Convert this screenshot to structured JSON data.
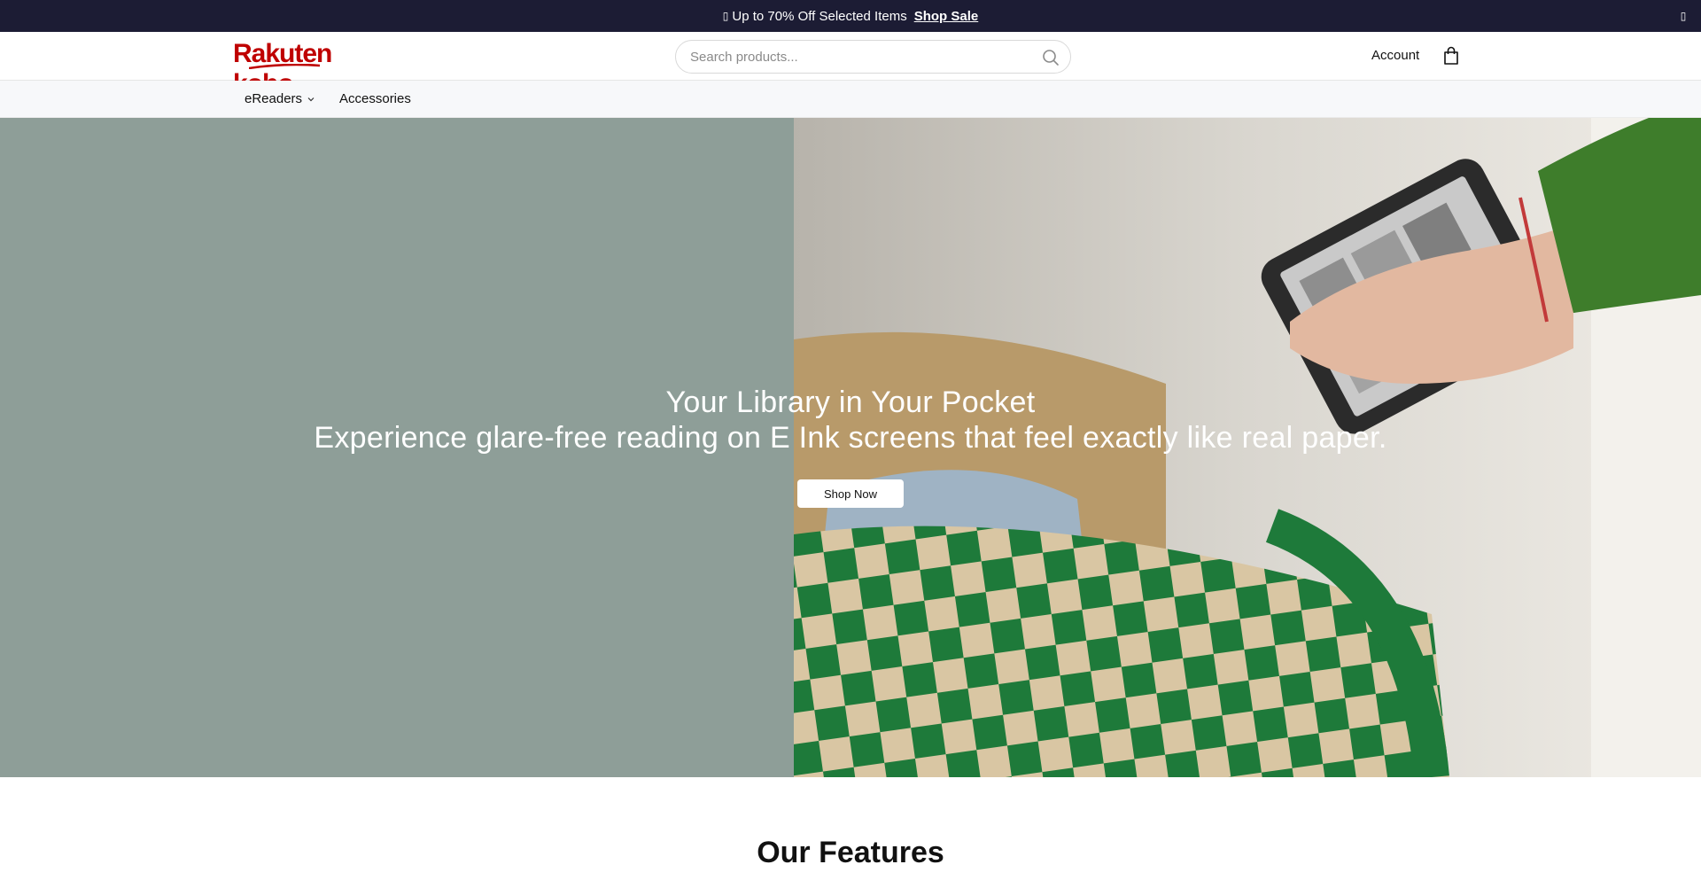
{
  "announcement": {
    "flag_glyph": "▯",
    "message": "Up to 70% Off Selected Items",
    "link_label": "Shop Sale",
    "dismiss_glyph": "▯"
  },
  "header": {
    "logo_text": "Rakuten kobo",
    "search_placeholder": "Search products...",
    "account_label": "Account",
    "icons": [
      "search-icon",
      "shopping-bag-icon"
    ]
  },
  "nav": {
    "items": [
      {
        "label": "eReaders",
        "has_dropdown": true
      },
      {
        "label": "Accessories",
        "has_dropdown": false
      }
    ]
  },
  "hero": {
    "title": "Your Library in Your Pocket",
    "subtitle": "Experience glare-free reading on E Ink screens that feel exactly like real paper.",
    "cta_label": "Shop Now",
    "bg_color": "#8e9e98"
  },
  "features": {
    "title": "Our Features"
  },
  "colors": {
    "announcement_bg": "#1c1c34",
    "brand_red": "#bf0000",
    "nav_bg": "#f7f8fa"
  }
}
